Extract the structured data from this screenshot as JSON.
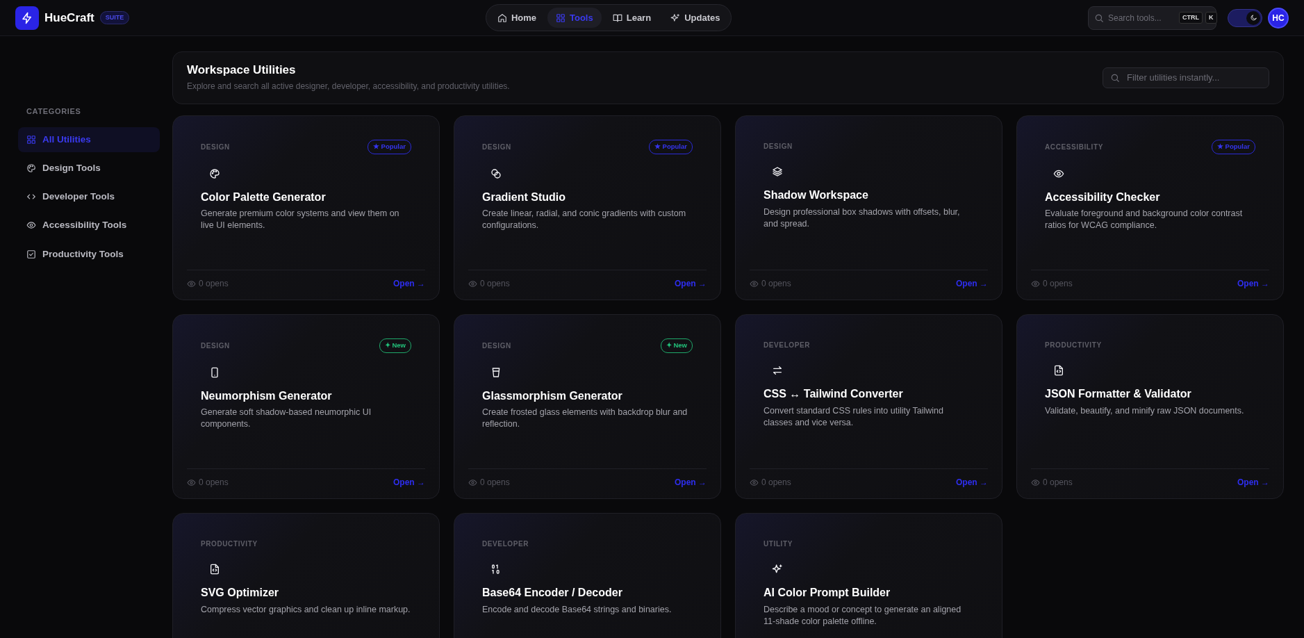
{
  "brand": {
    "name": "HueCraft",
    "badge": "SUITE"
  },
  "nav": [
    {
      "label": "Home",
      "selected": false
    },
    {
      "label": "Tools",
      "selected": true
    },
    {
      "label": "Learn",
      "selected": false
    },
    {
      "label": "Updates",
      "selected": false
    }
  ],
  "search": {
    "placeholder": "Search tools...",
    "shortcut": [
      "CTRL",
      "K"
    ]
  },
  "theme_toggle": {
    "on": true
  },
  "avatar": "HC",
  "sidebar": {
    "heading": "CATEGORIES",
    "items": [
      {
        "label": "All Utilities",
        "selected": true
      },
      {
        "label": "Design Tools",
        "selected": false
      },
      {
        "label": "Developer Tools",
        "selected": false
      },
      {
        "label": "Accessibility Tools",
        "selected": false
      },
      {
        "label": "Productivity Tools",
        "selected": false
      }
    ]
  },
  "header_panel": {
    "title": "Workspace Utilities",
    "subtitle": "Explore and search all active designer, developer, accessibility, and productivity utilities.",
    "filter_placeholder": "Filter utilities instantly..."
  },
  "cards": [
    {
      "category": "DESIGN",
      "badge": {
        "kind": "popular",
        "label": "★ Popular"
      },
      "title": "Color Palette Generator",
      "description": "Generate premium color systems and view them on live UI elements.",
      "opens": "0 opens",
      "action": "Open →"
    },
    {
      "category": "DESIGN",
      "badge": {
        "kind": "popular",
        "label": "★ Popular"
      },
      "title": "Gradient Studio",
      "description": "Create linear, radial, and conic gradients with custom configurations.",
      "opens": "0 opens",
      "action": "Open →"
    },
    {
      "category": "DESIGN",
      "title": "Shadow Workspace",
      "description": "Design professional box shadows with offsets, blur, and spread.",
      "opens": "0 opens",
      "action": "Open →"
    },
    {
      "category": "ACCESSIBILITY",
      "badge": {
        "kind": "popular",
        "label": "★ Popular"
      },
      "title": "Accessibility Checker",
      "description": "Evaluate foreground and background color contrast ratios for WCAG compliance.",
      "opens": "0 opens",
      "action": "Open →"
    },
    {
      "category": "DESIGN",
      "badge": {
        "kind": "new",
        "label": "✦ New"
      },
      "title": "Neumorphism Generator",
      "description": "Generate soft shadow-based neumorphic UI components.",
      "opens": "0 opens",
      "action": "Open →"
    },
    {
      "category": "DESIGN",
      "badge": {
        "kind": "new",
        "label": "✦ New"
      },
      "title": "Glassmorphism Generator",
      "description": "Create frosted glass elements with backdrop blur and reflection.",
      "opens": "0 opens",
      "action": "Open →"
    },
    {
      "category": "DEVELOPER",
      "title": "CSS ↔ Tailwind Converter",
      "description": "Convert standard CSS rules into utility Tailwind classes and vice versa.",
      "opens": "0 opens",
      "action": "Open →"
    },
    {
      "category": "PRODUCTIVITY",
      "title": "JSON Formatter & Validator",
      "description": "Validate, beautify, and minify raw JSON documents.",
      "opens": "0 opens",
      "action": "Open →"
    },
    {
      "category": "PRODUCTIVITY",
      "title": "SVG Optimizer",
      "description": "Compress vector graphics and clean up inline markup."
    },
    {
      "category": "DEVELOPER",
      "title": "Base64 Encoder / Decoder",
      "description": "Encode and decode Base64 strings and binaries."
    },
    {
      "category": "UTILITY",
      "title": "AI Color Prompt Builder",
      "description": "Describe a mood or concept to generate an aligned 11-shade color palette offline."
    }
  ]
}
